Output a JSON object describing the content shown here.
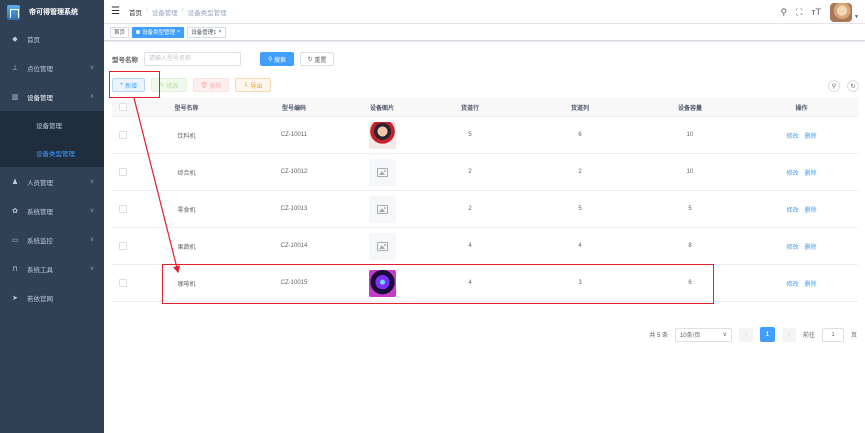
{
  "app": {
    "title": "帝可得管理系统"
  },
  "sidebar": {
    "items": [
      {
        "label": "首页",
        "icon": "dashboard-icon"
      },
      {
        "label": "点位管理",
        "icon": "location-icon"
      },
      {
        "label": "设备管理",
        "icon": "device-icon",
        "open": true,
        "children": [
          {
            "label": "设备管理"
          },
          {
            "label": "设备类型管理",
            "active": true
          }
        ]
      },
      {
        "label": "人员管理",
        "icon": "user-icon"
      },
      {
        "label": "系统管理",
        "icon": "settings-icon"
      },
      {
        "label": "系统监控",
        "icon": "monitor-icon"
      },
      {
        "label": "系统工具",
        "icon": "tool-icon"
      },
      {
        "label": "若依官网",
        "icon": "guide-icon"
      }
    ]
  },
  "navbar": {
    "breadcrumb": [
      "首页",
      "设备管理",
      "设备类型管理"
    ],
    "icons": [
      "search-icon",
      "fullscreen-icon",
      "font-size-icon",
      "avatar"
    ]
  },
  "tags": [
    {
      "label": "首页",
      "active": false
    },
    {
      "label": "设备类型管理",
      "active": true
    },
    {
      "label": "设备管理1",
      "active": false
    }
  ],
  "search": {
    "label": "型号名称",
    "placeholder": "请输入型号名称",
    "search_btn": "搜索",
    "reset_btn": "重置"
  },
  "toolbar": {
    "add": "新增",
    "edit": "修改",
    "delete": "删除",
    "export": "导出"
  },
  "table": {
    "headers": [
      "型号名称",
      "型号编码",
      "设备图片",
      "货道行",
      "货道列",
      "设备容量",
      "操作"
    ],
    "rows": [
      {
        "name": "饮料机",
        "code": "CZ-10011",
        "image": "photo-red",
        "rows": "5",
        "cols": "6",
        "capacity": "10"
      },
      {
        "name": "综合机",
        "code": "CZ-10012",
        "image": "placeholder",
        "rows": "2",
        "cols": "2",
        "capacity": "10"
      },
      {
        "name": "零食机",
        "code": "CZ-10013",
        "image": "placeholder",
        "rows": "2",
        "cols": "5",
        "capacity": "5"
      },
      {
        "name": "果蔬机",
        "code": "CZ-10014",
        "image": "placeholder",
        "rows": "4",
        "cols": "4",
        "capacity": "8"
      },
      {
        "name": "咖啡机",
        "code": "CZ-10015",
        "image": "photo-neon",
        "rows": "4",
        "cols": "3",
        "capacity": "6"
      }
    ],
    "ops": {
      "edit": "修改",
      "delete": "删除"
    }
  },
  "pagination": {
    "total": "共 5 条",
    "page_size": "10条/页",
    "current": "1",
    "goto_label": "前往",
    "goto_value": "1",
    "page_unit": "页"
  },
  "colors": {
    "primary": "#409eff",
    "sidebar_bg": "#304156",
    "annotation": "#e0202a"
  }
}
